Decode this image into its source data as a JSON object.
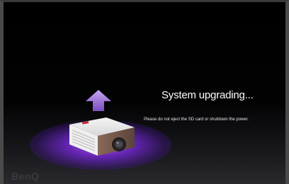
{
  "status": {
    "title": "System upgrading...",
    "message": "Please do not eject the SD card or shutdown the power."
  },
  "brand": {
    "logo_text": "BenQ",
    "projector_label": "BenQ"
  },
  "icons": {
    "upload_arrow": "upload-arrow-icon",
    "device": "projector-icon"
  },
  "colors": {
    "background": "#000000",
    "arrow": "#9b6fd3",
    "glow": "#8a3cf0",
    "text": "#ffffff"
  }
}
